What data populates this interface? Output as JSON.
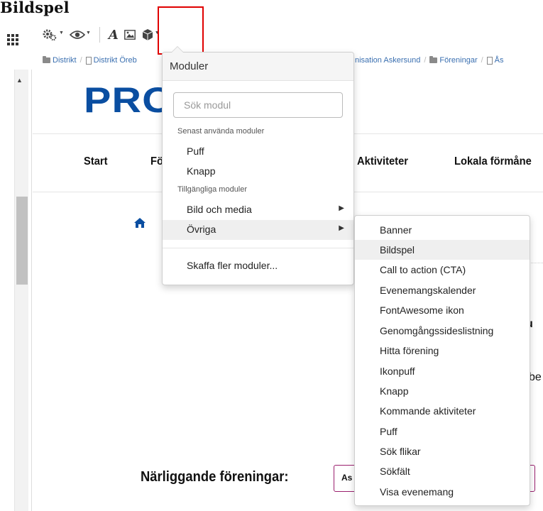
{
  "doc_title": "Bildspel",
  "toolbar": {
    "icons": [
      "apps-grid-icon",
      "settings-gears-icon",
      "eye-icon",
      "text-format-icon",
      "image-icon",
      "module-cube-icon"
    ],
    "italic_glyph": "A"
  },
  "breadcrumb": [
    {
      "icon": "folder-icon",
      "label": "Distrikt"
    },
    {
      "icon": "page-icon",
      "label": "Distrikt Öreb"
    },
    {
      "icon": "none",
      "label": "nisation Askersund"
    },
    {
      "icon": "folder-icon",
      "label": "Föreningar"
    },
    {
      "icon": "page-icon",
      "label": "Ås"
    }
  ],
  "page": {
    "logo_text": "PRO",
    "nav": {
      "start": "Start",
      "foreningar_fragment": "Fö",
      "aktiviteter": "Aktiviteter",
      "lokala_formaner": "Lokala förmåne"
    },
    "fragment_u": "u",
    "fragment_be": "be",
    "narliggande_label": "Närliggande föreningar:",
    "narliggande_button": "As"
  },
  "dropdown": {
    "title": "Moduler",
    "search_placeholder": "Sök modul",
    "recent_label": "Senast använda moduler",
    "recent": [
      "Puff",
      "Knapp"
    ],
    "available_label": "Tillgängliga moduler",
    "available": [
      "Bild och media",
      "Övriga"
    ],
    "more": "Skaffa fler moduler..."
  },
  "submenu": {
    "items": [
      "Banner",
      "Bildspel",
      "Call to action (CTA)",
      "Evenemangskalender",
      "FontAwesome ikon",
      "Genomgångssideslistning",
      "Hitta förening",
      "Ikonpuff",
      "Knapp",
      "Kommande aktiviteter",
      "Puff",
      "Sök flikar",
      "Sökfält",
      "Visa evenemang"
    ],
    "highlighted": "Bildspel"
  },
  "colors": {
    "highlight_border": "#e00000",
    "logo_blue": "#0a4ea1",
    "link_blue": "#3a6fb0",
    "button_border": "#9a1f6e",
    "menu_hover": "#efefef"
  }
}
